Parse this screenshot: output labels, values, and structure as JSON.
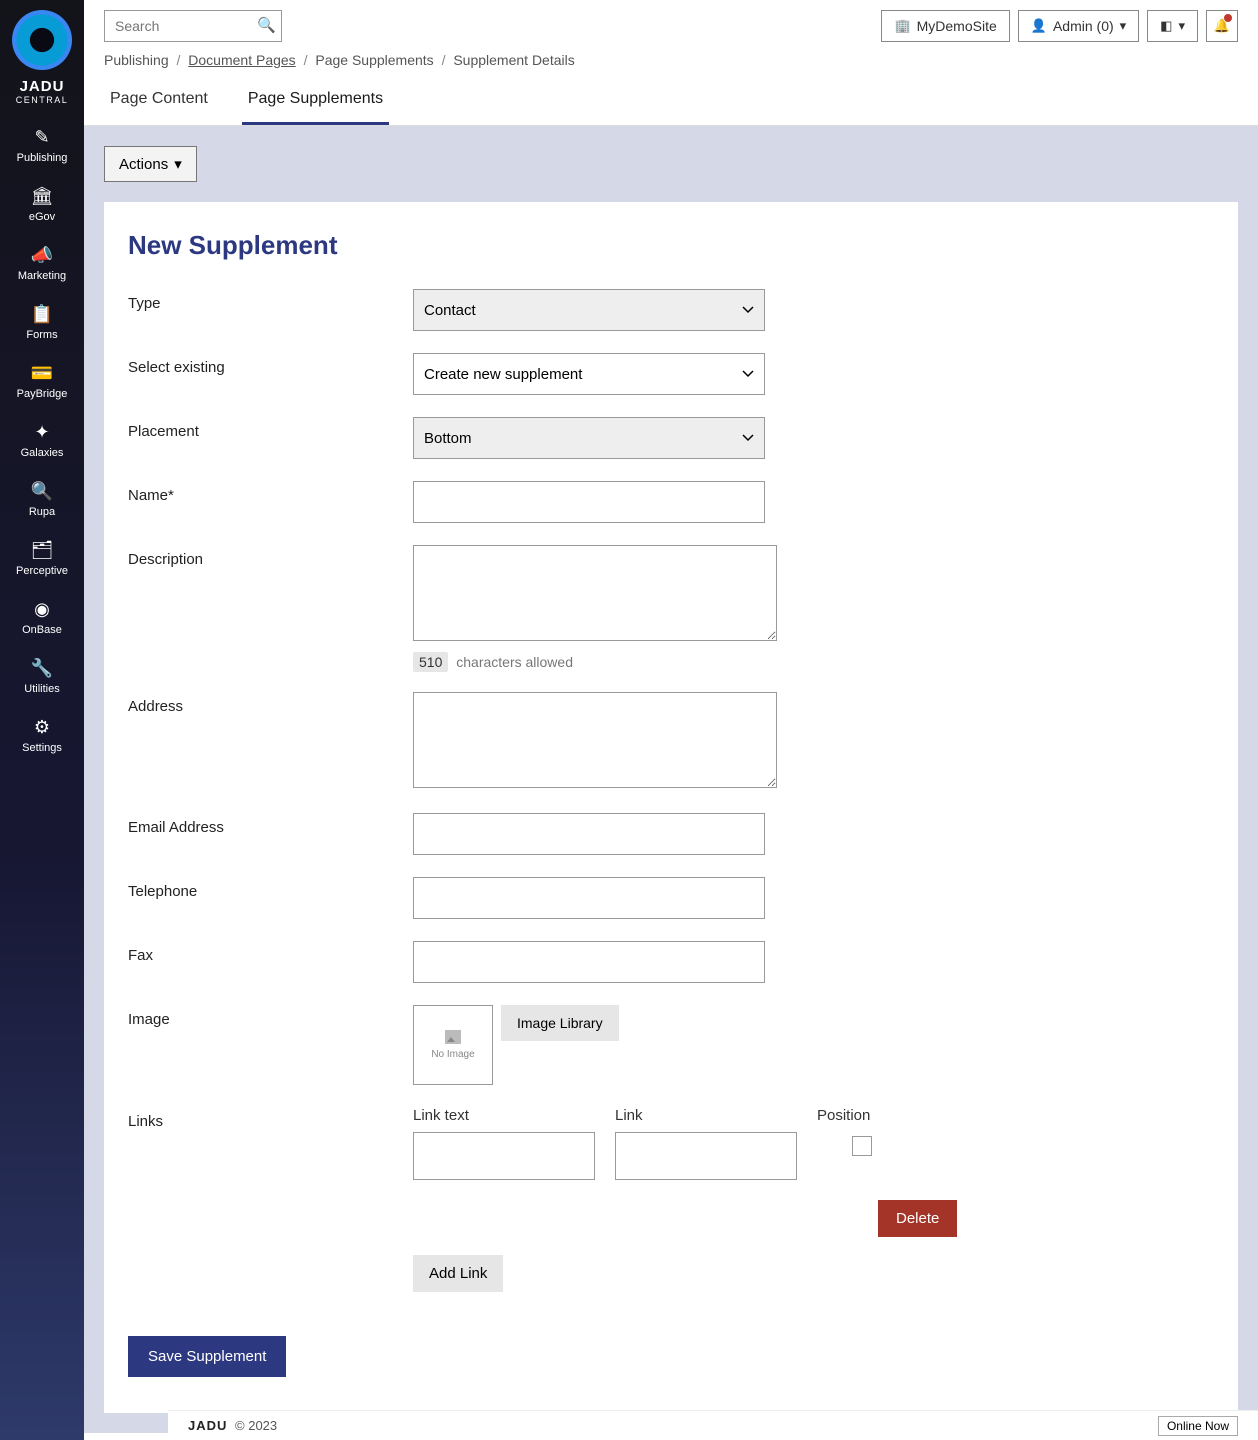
{
  "brand": {
    "name": "JADU",
    "sub": "CENTRAL"
  },
  "sidebar": {
    "items": [
      {
        "label": "Publishing",
        "icon": "✎"
      },
      {
        "label": "eGov",
        "icon": "🏛"
      },
      {
        "label": "Marketing",
        "icon": "📣"
      },
      {
        "label": "Forms",
        "icon": "📋"
      },
      {
        "label": "PayBridge",
        "icon": "💳"
      },
      {
        "label": "Galaxies",
        "icon": "⚬⚬⚬"
      },
      {
        "label": "Rupa",
        "icon": "🔍"
      },
      {
        "label": "Perceptive",
        "icon": "🗂"
      },
      {
        "label": "OnBase",
        "icon": "▶"
      },
      {
        "label": "Utilities",
        "icon": "🔧"
      },
      {
        "label": "Settings",
        "icon": "⚙"
      }
    ]
  },
  "topbar": {
    "search_placeholder": "Search",
    "site_button": "MyDemoSite",
    "admin_button": "Admin (0)"
  },
  "breadcrumb": {
    "items": [
      {
        "text": "Publishing",
        "link": false
      },
      {
        "text": "Document Pages",
        "link": true
      },
      {
        "text": "Page Supplements",
        "link": false
      },
      {
        "text": "Supplement Details",
        "link": false
      }
    ],
    "sep": "/"
  },
  "tabs": [
    {
      "label": "Page Content",
      "active": false
    },
    {
      "label": "Page Supplements",
      "active": true
    }
  ],
  "actions": {
    "label": "Actions"
  },
  "panel": {
    "title": "New Supplement",
    "fields": {
      "type_label": "Type",
      "type_value": "Contact",
      "select_existing_label": "Select existing",
      "select_existing_value": "Create new supplement",
      "placement_label": "Placement",
      "placement_value": "Bottom",
      "name_label": "Name*",
      "description_label": "Description",
      "char_count": "510",
      "char_text": "characters allowed",
      "address_label": "Address",
      "email_label": "Email Address",
      "telephone_label": "Telephone",
      "fax_label": "Fax",
      "image_label": "Image",
      "no_image": "No Image",
      "image_library": "Image Library",
      "links_label": "Links",
      "links_columns": {
        "text": "Link text",
        "link": "Link",
        "position": "Position"
      },
      "delete": "Delete",
      "add_link": "Add Link",
      "save": "Save Supplement"
    }
  },
  "footer": {
    "brand": "JADU",
    "copyright": "© 2023",
    "online": "Online Now"
  }
}
